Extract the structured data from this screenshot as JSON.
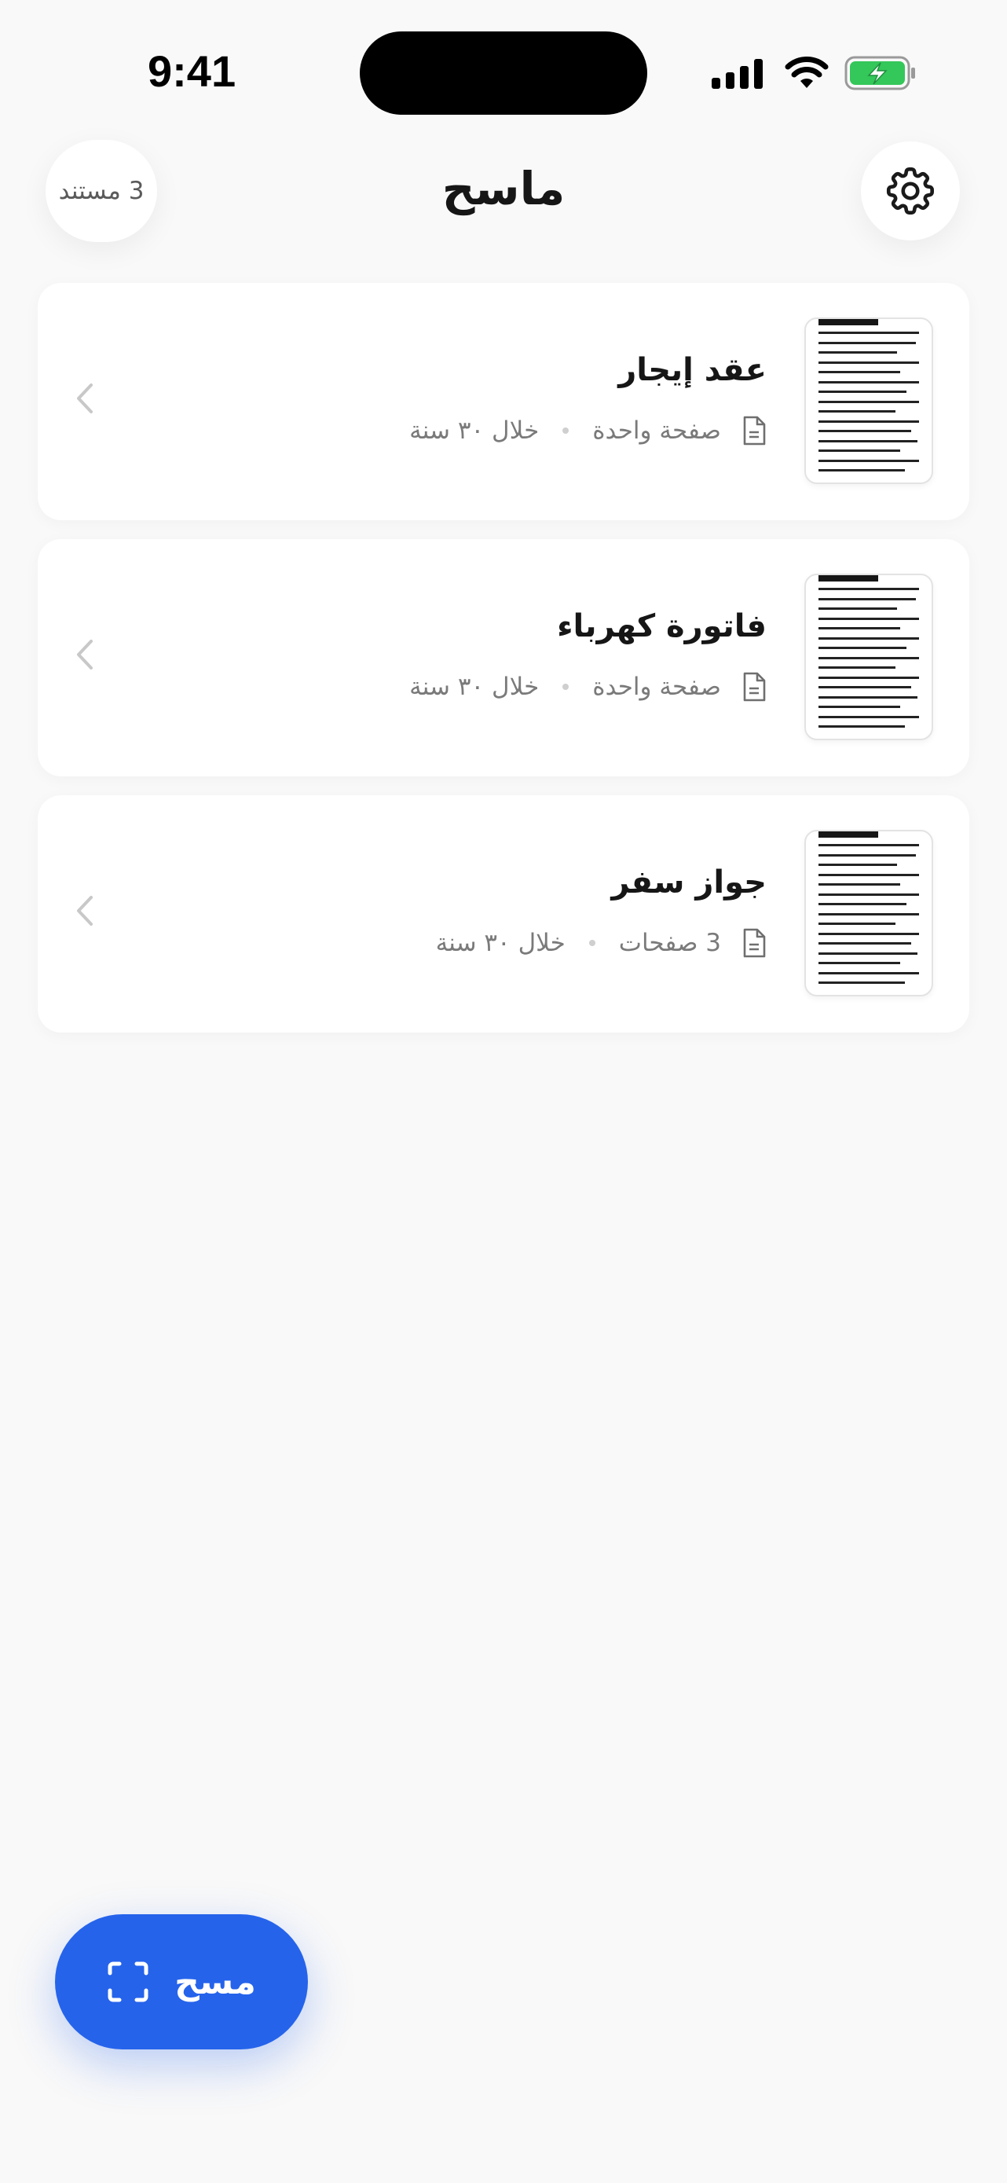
{
  "status_bar": {
    "time": "9:41"
  },
  "header": {
    "title": "ماسح",
    "document_count": "3 مستند"
  },
  "documents": [
    {
      "title": "عقد إيجار",
      "pages": "صفحة واحدة",
      "expiry": "خلال ٣٠ سنة"
    },
    {
      "title": "فاتورة كهرباء",
      "pages": "صفحة واحدة",
      "expiry": "خلال ٣٠ سنة"
    },
    {
      "title": "جواز سفر",
      "pages": "3 صفحات",
      "expiry": "خلال ٣٠ سنة"
    }
  ],
  "scan_button": {
    "label": "مسح",
    "icon": "scan-frame-icon"
  },
  "colors": {
    "accent": "#2563eb",
    "battery": "#34c759",
    "background": "#f9f9f9"
  }
}
